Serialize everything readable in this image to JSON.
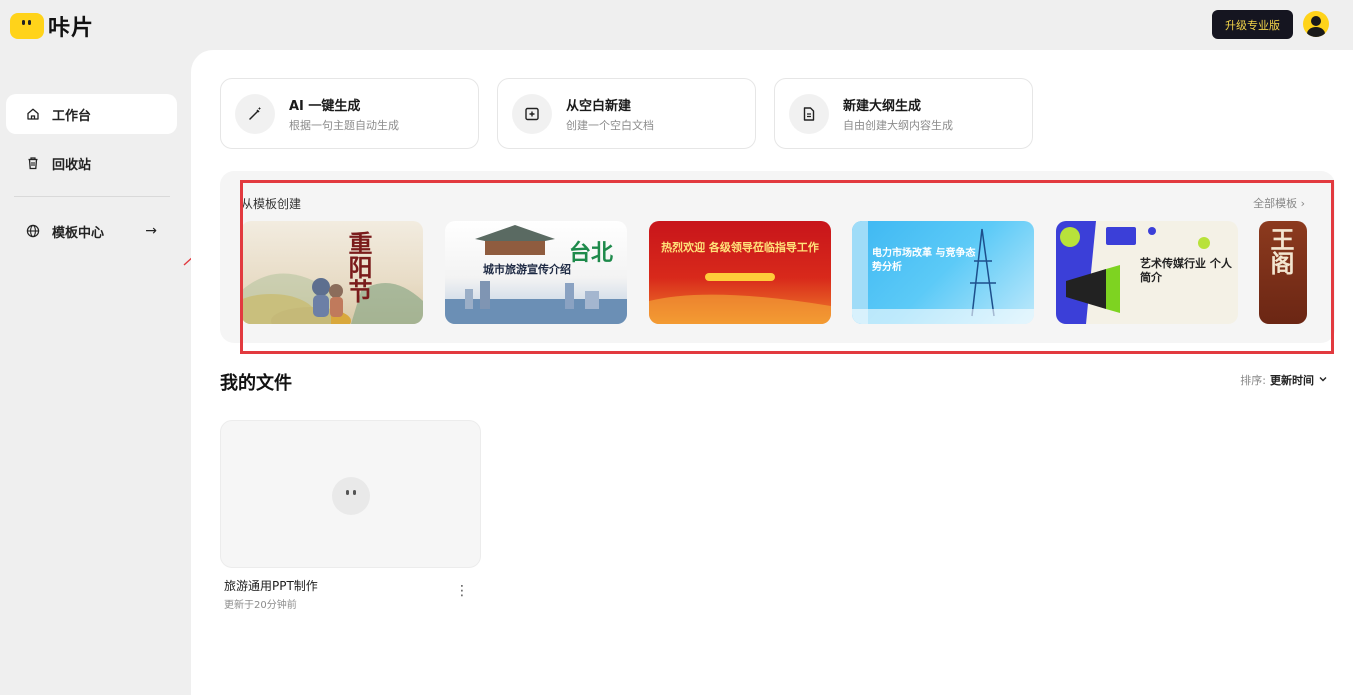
{
  "app": {
    "logo_text": "咔片"
  },
  "header": {
    "upgrade_label": "升级专业版"
  },
  "sidebar": {
    "items": [
      {
        "label": "工作台",
        "icon": "home-icon",
        "active": true
      },
      {
        "label": "回收站",
        "icon": "trash-icon",
        "active": false
      },
      {
        "label": "模板中心",
        "icon": "globe-icon",
        "active": false,
        "arrow": "→"
      }
    ]
  },
  "quick_actions": [
    {
      "title": "AI 一键生成",
      "subtitle": "根据一句主题自动生成",
      "icon": "magic-wand-icon"
    },
    {
      "title": "从空白新建",
      "subtitle": "创建一个空白文档",
      "icon": "add-square-icon"
    },
    {
      "title": "新建大纲生成",
      "subtitle": "自由创建大纲内容生成",
      "icon": "document-icon"
    }
  ],
  "templates": {
    "title": "从模板创建",
    "all_label": "全部模板 ›",
    "items": [
      {
        "title": "重阳节",
        "theme": "chongyang"
      },
      {
        "title": "城市旅游宣传介绍",
        "theme": "city-tour"
      },
      {
        "title": "热烈欢迎 各级领导莅临指导工作",
        "theme": "welcome-red"
      },
      {
        "title": "电力市场改革 与竞争态势分析",
        "theme": "power-blue"
      },
      {
        "title": "艺术传媒行业 个人简介",
        "theme": "art-media"
      },
      {
        "title": "王阁",
        "theme": "brown-partial"
      }
    ]
  },
  "files": {
    "title": "我的文件",
    "sort_label": "排序:",
    "sort_value": "更新时间",
    "items": [
      {
        "name": "旅游通用PPT制作",
        "updated": "更新于20分钟前"
      }
    ]
  },
  "colors": {
    "accent_yellow": "#ffd31a",
    "annotation_red": "#e23a3f",
    "upgrade_bg": "#151520",
    "upgrade_text": "#f4d64a"
  }
}
